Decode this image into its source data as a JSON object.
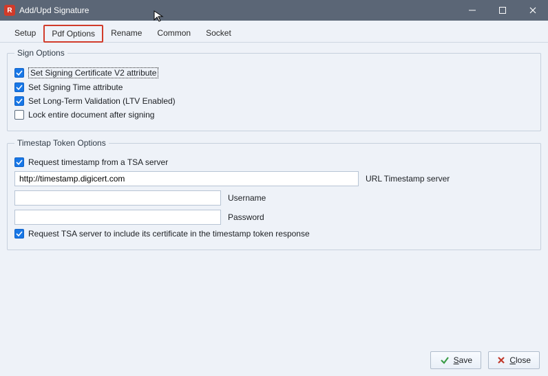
{
  "titlebar": {
    "appicon_letter": "R",
    "title": "Add/Upd Signature"
  },
  "tabs": {
    "setup": "Setup",
    "pdfoptions": "Pdf Options",
    "rename": "Rename",
    "common": "Common",
    "socket": "Socket"
  },
  "signOptions": {
    "legend": "Sign Options",
    "v2": "Set Signing Certificate V2 attribute",
    "time": "Set Signing Time attribute",
    "ltv": "Set Long-Term Validation (LTV Enabled)",
    "lock": "Lock entire document after signing"
  },
  "tsaOptions": {
    "legend": "Timestap Token Options",
    "request": "Request timestamp from a TSA server",
    "url_value": "http://timestamp.digicert.com",
    "url_label": "URL Timestamp server",
    "username_value": "",
    "username_label": "Username",
    "password_value": "",
    "password_label": "Password",
    "include_cert": "Request TSA server to include its certificate in the timestamp token response"
  },
  "footer": {
    "save_s": "S",
    "save_rest": "ave",
    "close_c": "C",
    "close_rest": "lose"
  }
}
